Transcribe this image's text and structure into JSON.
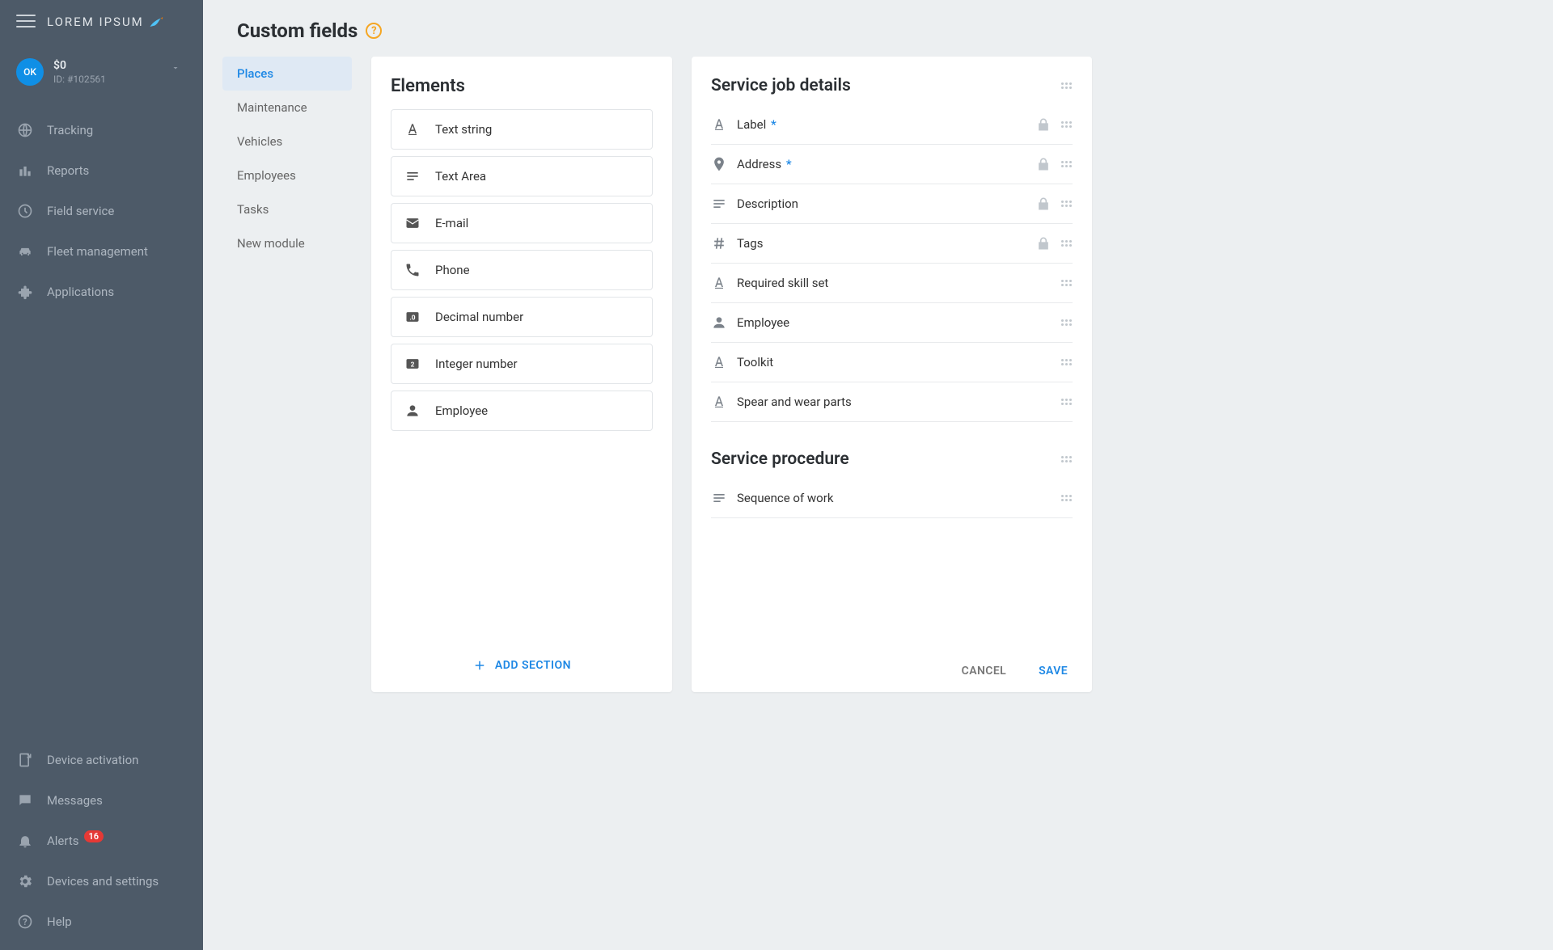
{
  "brand": "LOREM IPSUM",
  "user": {
    "initials": "OK",
    "balance": "$0",
    "id": "ID: #102561"
  },
  "nav_primary": [
    {
      "label": "Tracking",
      "icon": "globe"
    },
    {
      "label": "Reports",
      "icon": "bar-chart"
    },
    {
      "label": "Field service",
      "icon": "clock"
    },
    {
      "label": "Fleet management",
      "icon": "car"
    },
    {
      "label": "Applications",
      "icon": "puzzle"
    }
  ],
  "nav_secondary": [
    {
      "label": "Device activation",
      "icon": "device",
      "badge": null
    },
    {
      "label": "Messages",
      "icon": "message",
      "badge": null
    },
    {
      "label": "Alerts",
      "icon": "bell",
      "badge": "16"
    },
    {
      "label": "Devices and settings",
      "icon": "gear",
      "badge": null
    },
    {
      "label": "Help",
      "icon": "help",
      "badge": null
    }
  ],
  "page_title": "Custom fields",
  "tabs": [
    {
      "label": "Places",
      "active": true
    },
    {
      "label": "Maintenance",
      "active": false
    },
    {
      "label": "Vehicles",
      "active": false
    },
    {
      "label": "Employees",
      "active": false
    },
    {
      "label": "Tasks",
      "active": false
    },
    {
      "label": "New module",
      "active": false
    }
  ],
  "elements_title": "Elements",
  "elements": [
    {
      "label": "Text string",
      "icon": "text"
    },
    {
      "label": "Text Area",
      "icon": "textarea"
    },
    {
      "label": "E-mail",
      "icon": "mail"
    },
    {
      "label": "Phone",
      "icon": "phone"
    },
    {
      "label": "Decimal number",
      "icon": "decimal"
    },
    {
      "label": "Integer number",
      "icon": "integer"
    },
    {
      "label": "Employee",
      "icon": "person"
    }
  ],
  "add_section_label": "ADD SECTION",
  "details": {
    "sections": [
      {
        "title": "Service job details",
        "fields": [
          {
            "label": "Label",
            "icon": "text",
            "required": true,
            "locked": true
          },
          {
            "label": "Address",
            "icon": "place",
            "required": true,
            "locked": true
          },
          {
            "label": "Description",
            "icon": "textarea",
            "required": false,
            "locked": true
          },
          {
            "label": "Tags",
            "icon": "hash",
            "required": false,
            "locked": true
          },
          {
            "label": "Required skill set",
            "icon": "text",
            "required": false,
            "locked": false
          },
          {
            "label": "Employee",
            "icon": "person",
            "required": false,
            "locked": false
          },
          {
            "label": "Toolkit",
            "icon": "text",
            "required": false,
            "locked": false
          },
          {
            "label": "Spear and wear parts",
            "icon": "text",
            "required": false,
            "locked": false
          }
        ]
      },
      {
        "title": "Service procedure",
        "fields": [
          {
            "label": "Sequence of work",
            "icon": "textarea",
            "required": false,
            "locked": false
          }
        ]
      }
    ]
  },
  "actions": {
    "cancel": "CANCEL",
    "save": "SAVE"
  },
  "colors": {
    "accent": "#1e88e5",
    "warning": "#f5a623",
    "badge": "#e53935"
  }
}
